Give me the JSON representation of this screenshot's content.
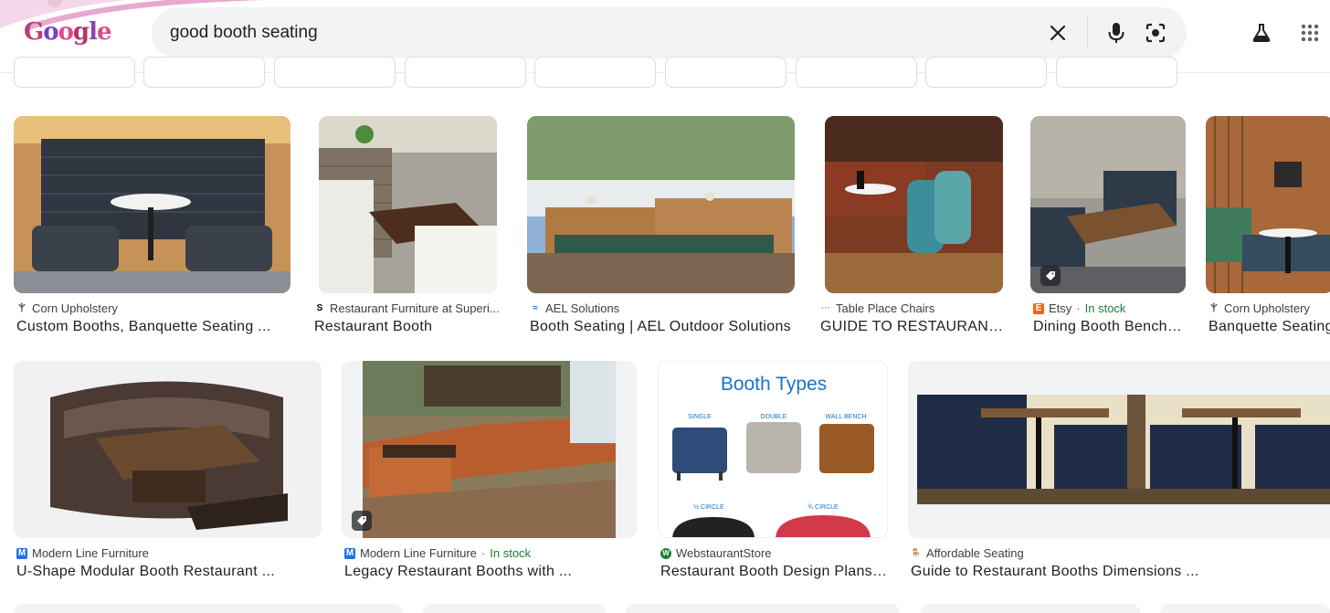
{
  "search": {
    "query": "good booth seating",
    "logo_text": "Google"
  },
  "colors": {
    "logo_letters": [
      "#c53a7a",
      "#7b3fbf",
      "#e24a86",
      "#b8336a",
      "#8e44ad",
      "#d94c8a"
    ],
    "in_stock": "#188038",
    "search_bg": "#f1f3f4"
  },
  "icons": {
    "clear": "close-icon",
    "mic": "microphone-icon",
    "lens": "camera-lens-icon",
    "labs": "flask-icon",
    "apps": "apps-grid-icon",
    "shopping_tag": "tag-icon"
  },
  "results": [
    {
      "source": "Corn Upholstery",
      "title": "Custom Booths, Banquette Seating ...",
      "favicon_text": "Ⲯ",
      "favicon_color": "#5f6368",
      "in_stock": false
    },
    {
      "source": "Restaurant Furniture at Superi...",
      "title": "Restaurant Booth",
      "favicon_text": "S",
      "favicon_color": "#000000",
      "in_stock": false
    },
    {
      "source": "AEL Solutions",
      "title": "Booth Seating | AEL Outdoor Solutions",
      "favicon_text": "≈",
      "favicon_color": "#1a73e8",
      "in_stock": false
    },
    {
      "source": "Table Place Chairs",
      "title": "GUIDE TO RESTAURANT BE...",
      "favicon_text": "···",
      "favicon_color": "#9aa0a6",
      "in_stock": false
    },
    {
      "source": "Etsy",
      "title": "Dining Booth Bench S...",
      "favicon_text": "E",
      "favicon_color": "#f1641e",
      "in_stock": true,
      "stock_label": "In stock"
    },
    {
      "source": "Corn Upholstery",
      "title": "Banquette Seating",
      "favicon_text": "Ⲯ",
      "favicon_color": "#5f6368",
      "in_stock": false
    },
    {
      "source": "Modern Line Furniture",
      "title": "U-Shape Modular Booth Restaurant ...",
      "favicon_text": "M",
      "favicon_color": "#1a73e8",
      "in_stock": false
    },
    {
      "source": "Modern Line Furniture",
      "title": "Legacy Restaurant Booths with ...",
      "favicon_text": "M",
      "favicon_color": "#1a73e8",
      "in_stock": true,
      "stock_label": "In stock"
    },
    {
      "source": "WebstaurantStore",
      "title": "Restaurant Booth Design Plans & ...",
      "favicon_text": "W",
      "favicon_color": "#188038",
      "in_stock": false
    },
    {
      "source": "Affordable Seating",
      "title": "Guide to Restaurant Booths Dimensions ...",
      "favicon_text": "🪑",
      "favicon_color": "#d93025",
      "in_stock": false
    }
  ],
  "thumbnail_texts": {
    "booth_types_title": "Booth Types",
    "labels": [
      "SINGLE",
      "DOUBLE",
      "WALL BENCH",
      "½ CIRCLE",
      "¾ CIRCLE"
    ]
  }
}
